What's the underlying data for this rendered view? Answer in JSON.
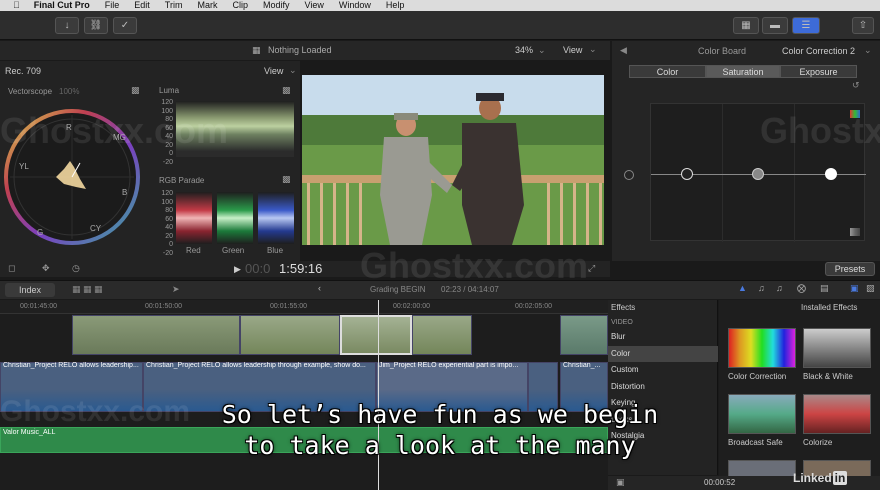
{
  "menu": {
    "apple": "",
    "app": "Final Cut Pro",
    "items": [
      "File",
      "Edit",
      "Trim",
      "Mark",
      "Clip",
      "Modify",
      "View",
      "Window",
      "Help"
    ]
  },
  "viewer": {
    "status": "Nothing Loaded",
    "zoom": "34%",
    "view_label": "View"
  },
  "scopes": {
    "color_space": "Rec. 709",
    "view_label": "View",
    "vectorscope_label": "Vectorscope",
    "vectorscope_pct": "100%",
    "luma_label": "Luma",
    "rgb_label": "RGB Parade",
    "scale": [
      "120",
      "100",
      "80",
      "60",
      "40",
      "20",
      "0",
      "-20"
    ],
    "channels": [
      "Red",
      "Green",
      "Blue"
    ],
    "vector_marks": [
      "R",
      "MG",
      "B",
      "CY",
      "G",
      "YL"
    ]
  },
  "timecode": {
    "dim": "00:0",
    "value": "1:59:16"
  },
  "inspector": {
    "title": "Color Board",
    "correction": "Color Correction 2",
    "tabs": [
      "Color",
      "Saturation",
      "Exposure"
    ],
    "selected_tab": "Saturation",
    "presets": "Presets",
    "puck_levels": [
      0.1,
      0.5,
      0.85
    ]
  },
  "timeline": {
    "index": "Index",
    "clip_name": "Grading BEGIN",
    "timecode": "02:23 / 04:14:07",
    "ruler": [
      "00:01:45:00",
      "00:01:50:00",
      "00:01:55:00",
      "00:02:00:00",
      "00:02:05:00"
    ],
    "clips": [
      "Christian_Project RELO allows leadership...",
      "Christian_Project RELO allows leadership through example, show do...",
      "Jim_Project RELO experiential part is impo...",
      "Christian_..."
    ],
    "music": "Valor Music_ALL",
    "current_time": "00:00:52"
  },
  "effects": {
    "title": "Effects",
    "installed": "Installed Effects",
    "category_header": "VIDEO",
    "categories": [
      "Blur",
      "Color",
      "Custom",
      "Distortion",
      "Keying",
      "Looks",
      "Nostalgia"
    ],
    "selected": "Color",
    "thumbs": [
      "Color Correction",
      "Black & White",
      "Broadcast Safe",
      "Colorize"
    ]
  },
  "subtitle": {
    "line1": "So let’s have fun as we begin",
    "line2": "to take a look at the many"
  },
  "watermark": {
    "text": "Ghostxx.com",
    "brand": "Linked",
    "brand_in": "in"
  }
}
